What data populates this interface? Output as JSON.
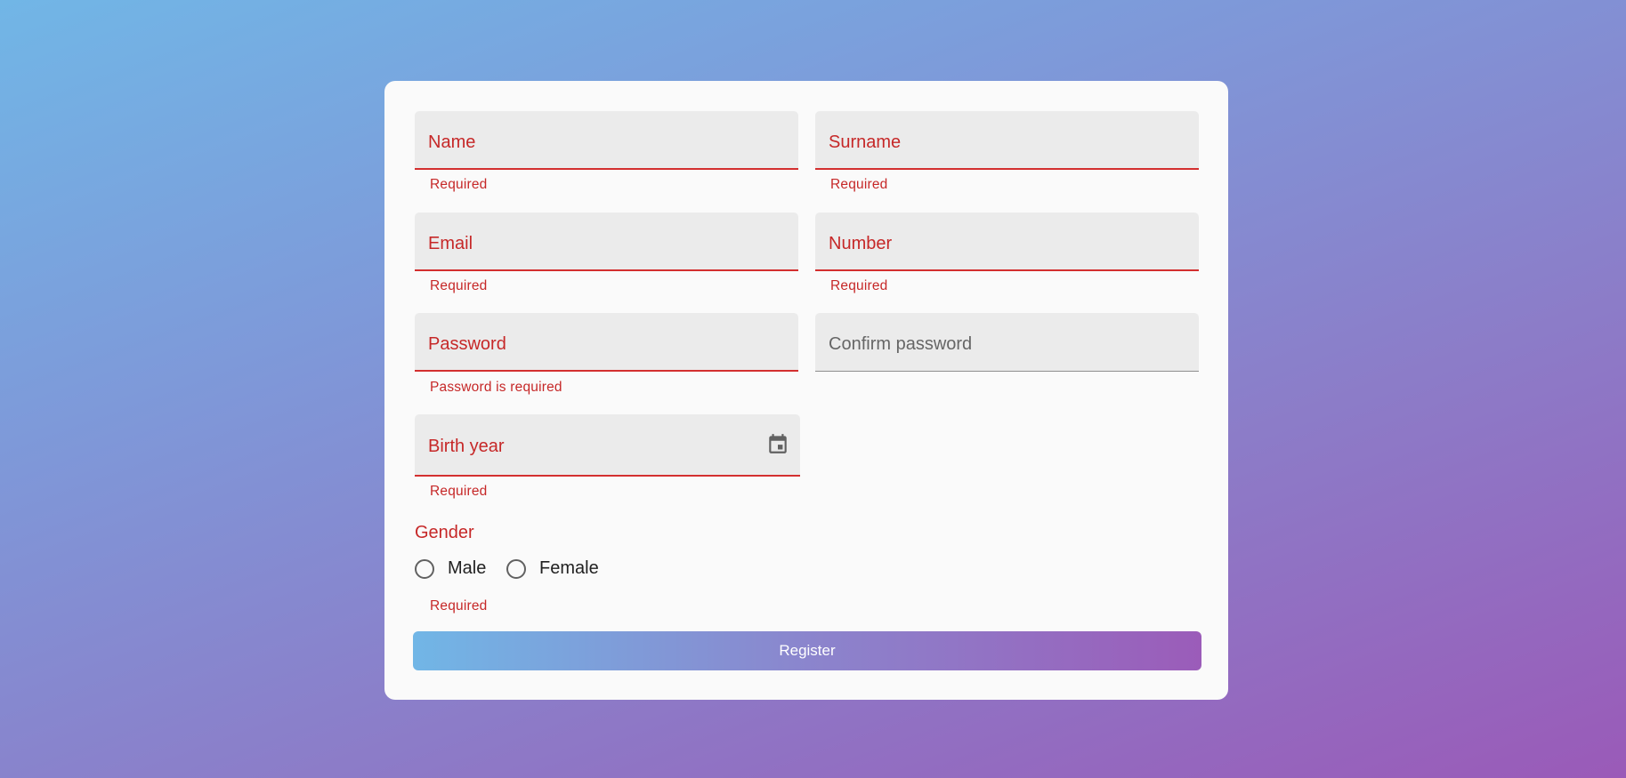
{
  "form": {
    "fields": {
      "name": {
        "label": "Name",
        "hint": "Required"
      },
      "surname": {
        "label": "Surname",
        "hint": "Required"
      },
      "email": {
        "label": "Email",
        "hint": "Required"
      },
      "number": {
        "label": "Number",
        "hint": "Required"
      },
      "password": {
        "label": "Password",
        "hint": "Password is required"
      },
      "confirm_password": {
        "label": "Confirm password",
        "hint": ""
      },
      "birth_year": {
        "label": "Birth year",
        "hint": "Required",
        "icon": "calendar-icon"
      }
    },
    "gender": {
      "label": "Gender",
      "options": [
        "Male",
        "Female"
      ],
      "hint": "Required"
    },
    "register_label": "Register"
  },
  "colors": {
    "error": "#c62828",
    "field_bg": "#ebebeb",
    "card_bg": "#fafafa",
    "gradient_start": "#71b6e6",
    "gradient_end": "#9b5cb9"
  }
}
